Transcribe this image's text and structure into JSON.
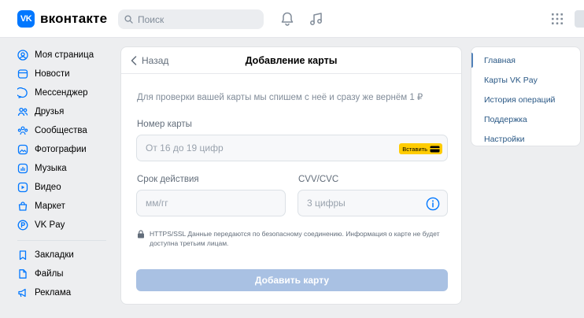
{
  "header": {
    "logo_mark": "VK",
    "logo_text": "вконтакте",
    "search_placeholder": "Поиск"
  },
  "leftnav": {
    "items": [
      {
        "label": "Моя страница",
        "icon": "profile-icon"
      },
      {
        "label": "Новости",
        "icon": "news-icon"
      },
      {
        "label": "Мессенджер",
        "icon": "message-icon"
      },
      {
        "label": "Друзья",
        "icon": "friends-icon"
      },
      {
        "label": "Сообщества",
        "icon": "communities-icon"
      },
      {
        "label": "Фотографии",
        "icon": "photo-icon"
      },
      {
        "label": "Музыка",
        "icon": "music-icon"
      },
      {
        "label": "Видео",
        "icon": "video-icon"
      },
      {
        "label": "Маркет",
        "icon": "market-icon"
      },
      {
        "label": "VK Pay",
        "icon": "vkpay-icon"
      }
    ],
    "extra": [
      {
        "label": "Закладки",
        "icon": "bookmark-icon"
      },
      {
        "label": "Файлы",
        "icon": "file-icon"
      },
      {
        "label": "Реклама",
        "icon": "ads-icon"
      }
    ]
  },
  "card": {
    "back_label": "Назад",
    "title": "Добавление карты",
    "info": "Для проверки вашей карты мы спишем с неё и сразу же вернём 1 ₽",
    "card_number_label": "Номер карты",
    "card_number_placeholder": "От 16 до 19 цифр",
    "paste_label": "Вставить",
    "expiry_label": "Срок действия",
    "expiry_placeholder": "мм/гг",
    "cvv_label": "CVV/CVC",
    "cvv_placeholder": "3 цифры",
    "secure_text": "HTTPS/SSL Данные передаются по безопасному соединению. Информация о карте не будет доступна третьим лицам.",
    "submit_label": "Добавить карту"
  },
  "rightnav": {
    "items": [
      {
        "label": "Главная",
        "active": true
      },
      {
        "label": "Карты VK Pay",
        "active": false
      },
      {
        "label": "История операций",
        "active": false
      },
      {
        "label": "Поддержка",
        "active": false
      },
      {
        "label": "Настройки",
        "active": false
      }
    ]
  },
  "colors": {
    "accent": "#0077ff",
    "link": "#2a5885",
    "button_disabled": "#a9c1e3",
    "paste_yellow": "#ffcc00",
    "background": "#edeef0"
  }
}
